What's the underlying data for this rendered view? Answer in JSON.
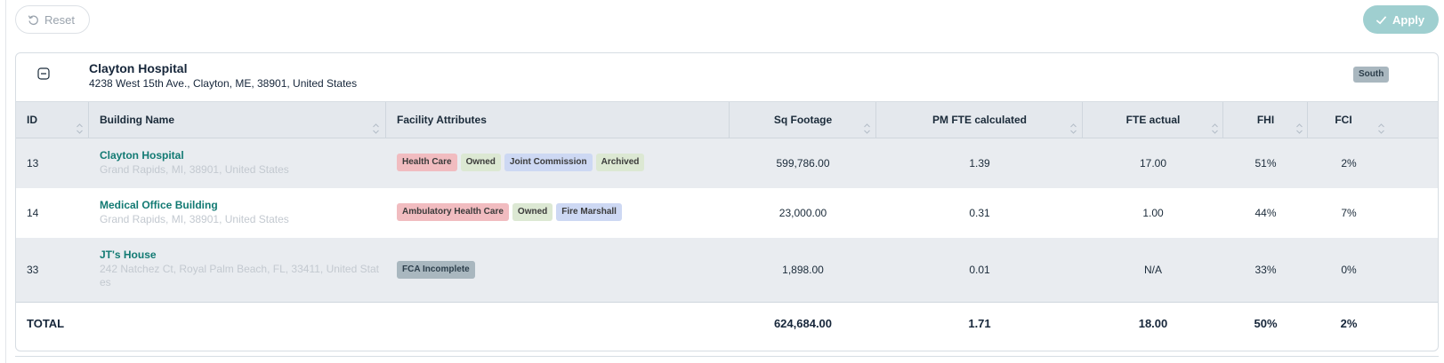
{
  "toolbar": {
    "reset_label": "Reset",
    "apply_label": "Apply"
  },
  "facility": {
    "name": "Clayton Hospital",
    "address": "4238 West 15th Ave., Clayton, ME, 38901, United States",
    "region": "South"
  },
  "table": {
    "headers": {
      "id": "ID",
      "building_name": "Building Name",
      "facility_attributes": "Facility Attributes",
      "sq_footage": "Sq Footage",
      "pm_fte": "PM FTE calculated",
      "fte_actual": "FTE actual",
      "fhi": "FHI",
      "fci": "FCI"
    },
    "rows": [
      {
        "id": "13",
        "name": "Clayton Hospital",
        "address": "Grand Rapids, MI, 38901, United States",
        "tags": [
          "Health Care",
          "Owned",
          "Joint Commission",
          "Archived"
        ],
        "sq_footage": "599,786.00",
        "pm_fte": "1.39",
        "fte_actual": "17.00",
        "fhi": "51%",
        "fci": "2%"
      },
      {
        "id": "14",
        "name": "Medical Office Building",
        "address": "Grand Rapids, MI, 38901, United States",
        "tags": [
          "Ambulatory Health Care",
          "Owned",
          "Fire Marshall"
        ],
        "sq_footage": "23,000.00",
        "pm_fte": "0.31",
        "fte_actual": "1.00",
        "fhi": "44%",
        "fci": "7%"
      },
      {
        "id": "33",
        "name": "JT's House",
        "address": "242 Natchez Ct, Royal Palm Beach, FL, 33411, United States",
        "tags": [
          "FCA Incomplete"
        ],
        "sq_footage": "1,898.00",
        "pm_fte": "0.01",
        "fte_actual": "N/A",
        "fhi": "33%",
        "fci": "0%"
      }
    ],
    "total": {
      "label": "TOTAL",
      "sq_footage": "624,684.00",
      "pm_fte": "1.71",
      "fte_actual": "18.00",
      "fhi": "50%",
      "fci": "2%"
    }
  },
  "colors": {
    "link": "#127a73",
    "apply_button": "#9fcfd0",
    "header_bg": "#e4e8ed",
    "tag_red": "#f1bcc0",
    "tag_green": "#dce8d3",
    "tag_blue": "#cdd8f3",
    "tag_slate": "#a9b7bf"
  }
}
